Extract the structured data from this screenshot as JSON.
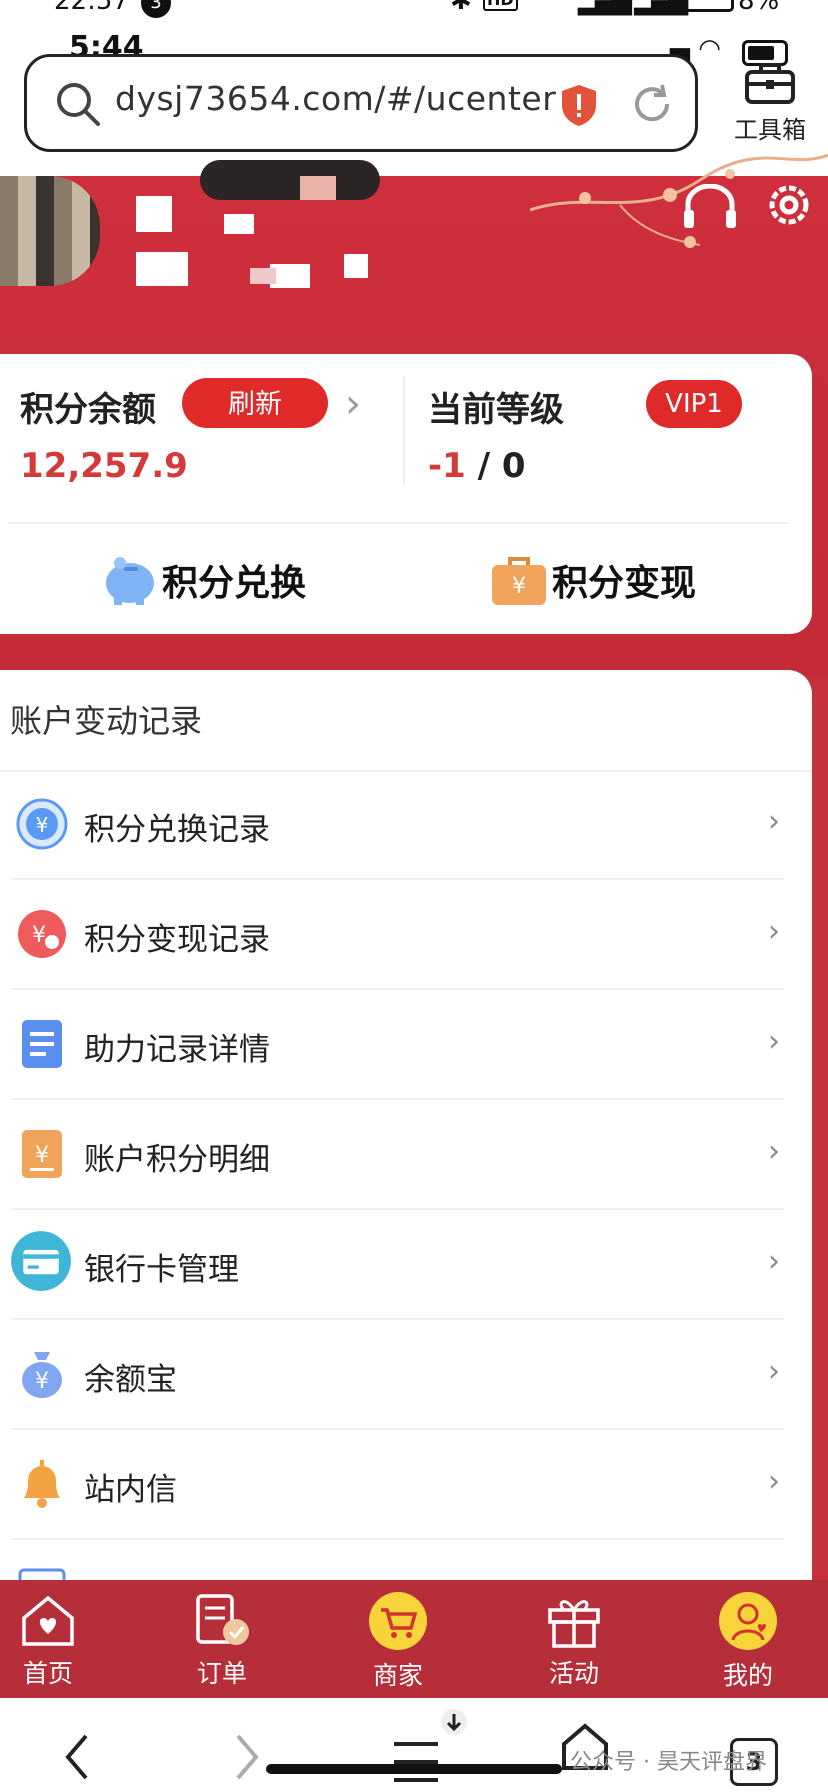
{
  "status_outer": {
    "time": "22:57",
    "badge": "3",
    "hd": "HD",
    "battery": "8%"
  },
  "status_inner": {
    "time": "5:44"
  },
  "browser": {
    "url": "dysj73654.com/#/ucenter",
    "toolbox_label": "工具箱"
  },
  "card": {
    "balance_label": "积分余额",
    "refresh_label": "刷新",
    "balance_value": "12,257.9",
    "level_label": "当前等级",
    "vip_badge": "VIP1",
    "level_current": "-1",
    "level_sep": " / ",
    "level_total": "0",
    "exchange_label": "积分兑换",
    "cashout_label": "积分变现"
  },
  "records": {
    "title": "账户变动记录",
    "items": [
      {
        "label": "积分兑换记录",
        "icon": "exchange-record-icon"
      },
      {
        "label": "积分变现记录",
        "icon": "cashout-record-icon"
      },
      {
        "label": "助力记录详情",
        "icon": "document-icon"
      },
      {
        "label": "账户积分明细",
        "icon": "points-detail-icon"
      },
      {
        "label": "银行卡管理",
        "icon": "bank-card-icon"
      },
      {
        "label": "余额宝",
        "icon": "money-bag-icon"
      },
      {
        "label": "站内信",
        "icon": "bell-icon"
      }
    ],
    "chevron": "›"
  },
  "tabs": [
    {
      "label": "首页",
      "icon": "home-icon"
    },
    {
      "label": "订单",
      "icon": "order-icon"
    },
    {
      "label": "商家",
      "icon": "cart-icon"
    },
    {
      "label": "活动",
      "icon": "gift-icon"
    },
    {
      "label": "我的",
      "icon": "user-icon"
    }
  ],
  "nav": {
    "tabs_count": "3",
    "watermark": "公众号 · 昊天评盘界"
  },
  "colors": {
    "brand_red": "#c5303a",
    "accent_red": "#e02a2a",
    "tabbar": "#b52e39",
    "balance_red": "#d33a3a"
  }
}
